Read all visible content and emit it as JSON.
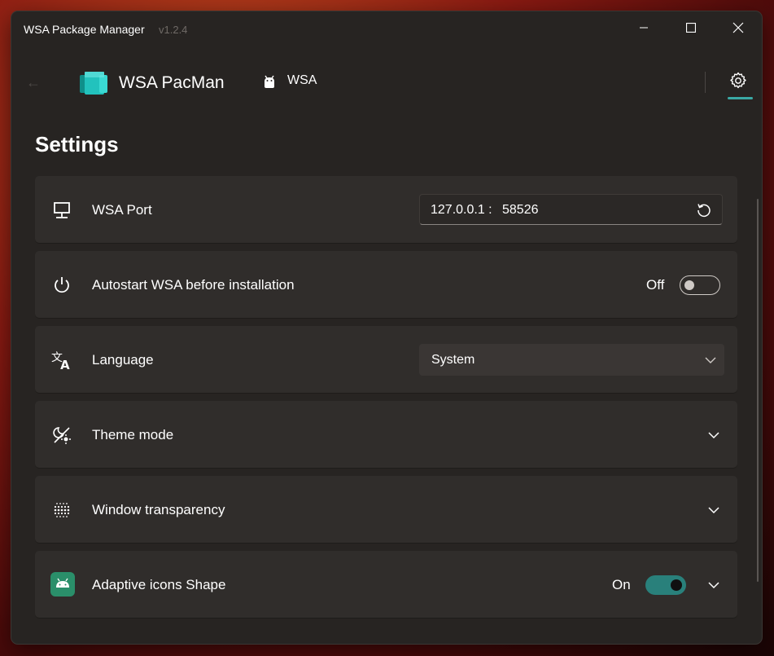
{
  "titlebar": {
    "title": "WSA Package Manager",
    "version": "v1.2.4"
  },
  "nav": {
    "app_name": "WSA PacMan",
    "wsa_label": "WSA"
  },
  "page": {
    "title": "Settings"
  },
  "settings": {
    "port": {
      "label": "WSA Port",
      "host": "127.0.0.1 :",
      "value": "58526"
    },
    "autostart": {
      "label": "Autostart WSA before installation",
      "state_text": "Off"
    },
    "language": {
      "label": "Language",
      "selected": "System"
    },
    "theme": {
      "label": "Theme mode"
    },
    "transparency": {
      "label": "Window transparency"
    },
    "adaptive": {
      "label": "Adaptive icons Shape",
      "state_text": "On"
    }
  },
  "colors": {
    "accent": "#3aa9a5",
    "toggle_on": "#29807b",
    "card_bg": "#302d2b",
    "window_bg": "#272422"
  }
}
